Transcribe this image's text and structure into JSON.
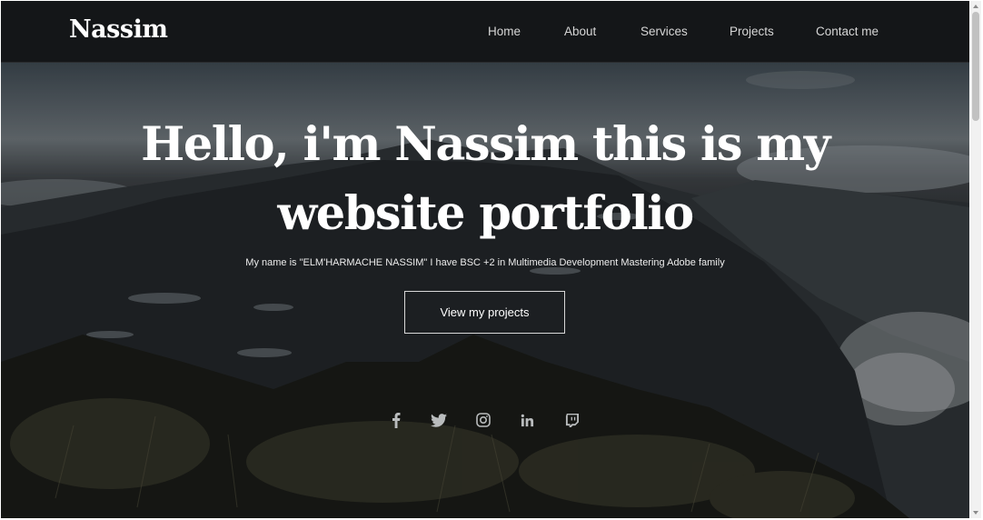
{
  "brand": "Nassim",
  "nav": {
    "home": "Home",
    "about": "About",
    "services": "Services",
    "projects": "Projects",
    "contact": "Contact me"
  },
  "hero": {
    "title_line1": "Hello, i'm Nassim this is my",
    "title_line2": "website portfolio",
    "subtitle": "My name is \"ELM'HARMACHE NASSIM\" I have BSC +2 in Multimedia Development Mastering Adobe family",
    "cta_label": "View my projects"
  },
  "social_icons": [
    "facebook-icon",
    "twitter-icon",
    "instagram-icon",
    "linkedin-icon",
    "twitch-icon"
  ],
  "colors": {
    "navbar_bg": "#141618",
    "text": "#ffffff",
    "nav_text": "#d6d6d6",
    "icon": "#b9bcbd"
  }
}
